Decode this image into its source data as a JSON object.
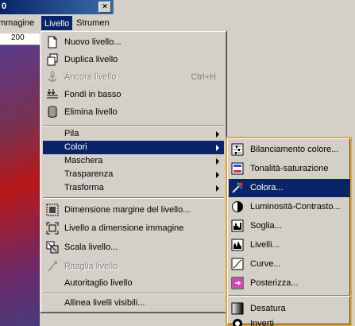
{
  "window": {
    "title_fragment": "0",
    "close_glyph": "×",
    "menubar": {
      "immagine": "mmagine",
      "livello": "Livello",
      "strumenti": "Strumen"
    },
    "ruler_tick": "200"
  },
  "layer_menu": {
    "items": [
      {
        "label": "Nuovo livello...",
        "icon": "new-layer-icon"
      },
      {
        "label": "Duplica livello",
        "icon": "duplicate-icon"
      },
      {
        "label": "Àncora livello",
        "icon": "anchor-icon",
        "shortcut": "Ctrl+H",
        "disabled": true
      },
      {
        "label": "Fondi in basso",
        "icon": "merge-down-icon"
      },
      {
        "label": "Elimina livello",
        "icon": "delete-icon"
      },
      {
        "label": "Pila"
      },
      {
        "label": "Colori"
      },
      {
        "label": "Maschera"
      },
      {
        "label": "Trasparenza"
      },
      {
        "label": "Trasforma"
      },
      {
        "label": "Dimensione margine del livello...",
        "icon": "boundary-size-icon"
      },
      {
        "label": "Livello a dimensione immagine",
        "icon": "layer-to-image-icon"
      },
      {
        "label": "Scala livello...",
        "icon": "scale-icon"
      },
      {
        "label": "Ritaglia livello",
        "icon": "crop-icon",
        "disabled": true
      },
      {
        "label": "Autoritaglio livello"
      },
      {
        "label": "Allinea livelli visibili..."
      }
    ]
  },
  "colors_submenu": {
    "items": [
      {
        "label": "Bilanciamento colore...",
        "icon": "color-balance-icon"
      },
      {
        "label": "Tonalità-saturazione",
        "icon": "hue-saturation-icon"
      },
      {
        "label": "Colora...",
        "icon": "colorize-icon"
      },
      {
        "label": "Luminosità-Contrasto...",
        "icon": "brightness-contrast-icon"
      },
      {
        "label": "Soglia...",
        "icon": "threshold-icon"
      },
      {
        "label": "Livelli...",
        "icon": "levels-icon"
      },
      {
        "label": "Curve...",
        "icon": "curves-icon"
      },
      {
        "label": "Posterizza...",
        "icon": "posterize-icon"
      },
      {
        "label": "Desatura",
        "icon": "desaturate-icon"
      },
      {
        "label": "Inverti",
        "icon": "invert-icon"
      }
    ]
  }
}
